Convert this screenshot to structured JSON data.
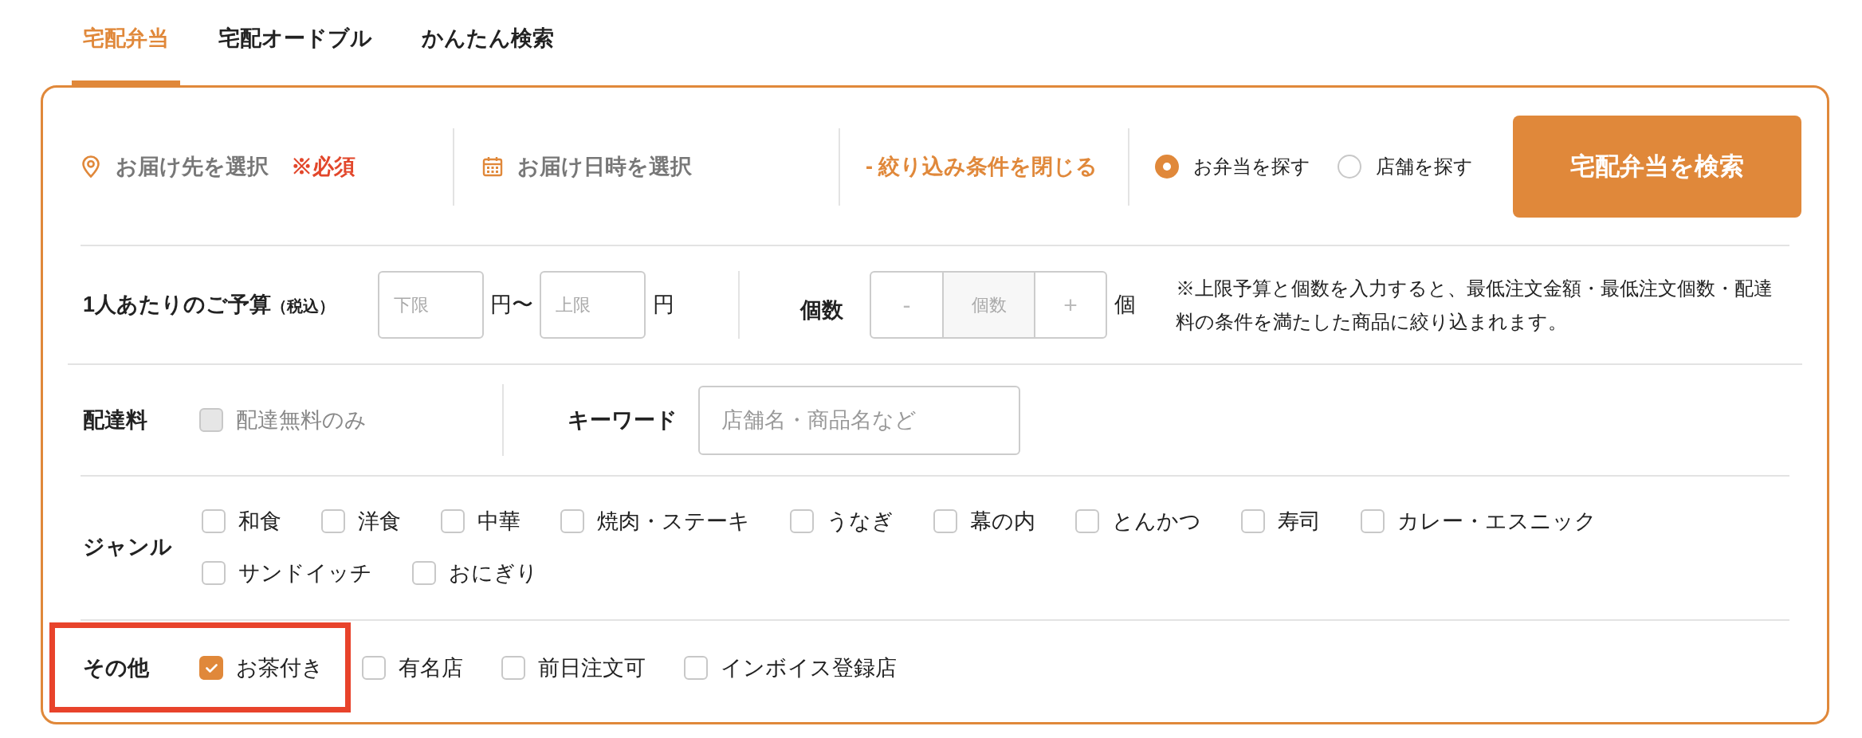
{
  "tabs": [
    {
      "label": "宅配弁当",
      "selected": true
    },
    {
      "label": "宅配オードブル",
      "selected": false
    },
    {
      "label": "かんたん検索",
      "selected": false
    }
  ],
  "search_bar": {
    "destination": {
      "label": "お届け先を選択",
      "required_note": "※必須"
    },
    "delivery_time": {
      "label": "お届け日時を選択"
    },
    "toggle_filters": "- 絞り込み条件を閉じる",
    "search_modes": [
      {
        "label": "お弁当を探す",
        "selected": true
      },
      {
        "label": "店舗を探す",
        "selected": false
      }
    ],
    "search_button": "宅配弁当を検索"
  },
  "budget": {
    "label": "1人あたりのご予算",
    "tax_note": "（税込）",
    "min": {
      "placeholder": "下限"
    },
    "min_unit": "円〜",
    "max": {
      "placeholder": "上限"
    },
    "max_unit": "円"
  },
  "quantity": {
    "label": "個数",
    "decrement": "-",
    "field": {
      "placeholder": "個数"
    },
    "increment": "+",
    "unit": "個",
    "note": "※上限予算と個数を入力すると、最低注文金額・最低注文個数・配達料の条件を満たした商品に絞り込まれます。"
  },
  "delivery_fee": {
    "label": "配達料",
    "option": {
      "label": "配達無料のみ",
      "checked": false,
      "disabled": true
    }
  },
  "keyword": {
    "label": "キーワード",
    "placeholder": "店舗名・商品名など"
  },
  "genre": {
    "label": "ジャンル",
    "options": [
      {
        "label": "和食",
        "checked": false
      },
      {
        "label": "洋食",
        "checked": false
      },
      {
        "label": "中華",
        "checked": false
      },
      {
        "label": "焼肉・ステーキ",
        "checked": false
      },
      {
        "label": "うなぎ",
        "checked": false
      },
      {
        "label": "幕の内",
        "checked": false
      },
      {
        "label": "とんかつ",
        "checked": false
      },
      {
        "label": "寿司",
        "checked": false
      },
      {
        "label": "カレー・エスニック",
        "checked": false
      },
      {
        "label": "サンドイッチ",
        "checked": false
      },
      {
        "label": "おにぎり",
        "checked": false
      }
    ]
  },
  "other": {
    "label": "その他",
    "highlighted": true,
    "options": [
      {
        "label": "お茶付き",
        "checked": true
      },
      {
        "label": "有名店",
        "checked": false
      },
      {
        "label": "前日注文可",
        "checked": false
      },
      {
        "label": "インボイス登録店",
        "checked": false
      }
    ]
  }
}
